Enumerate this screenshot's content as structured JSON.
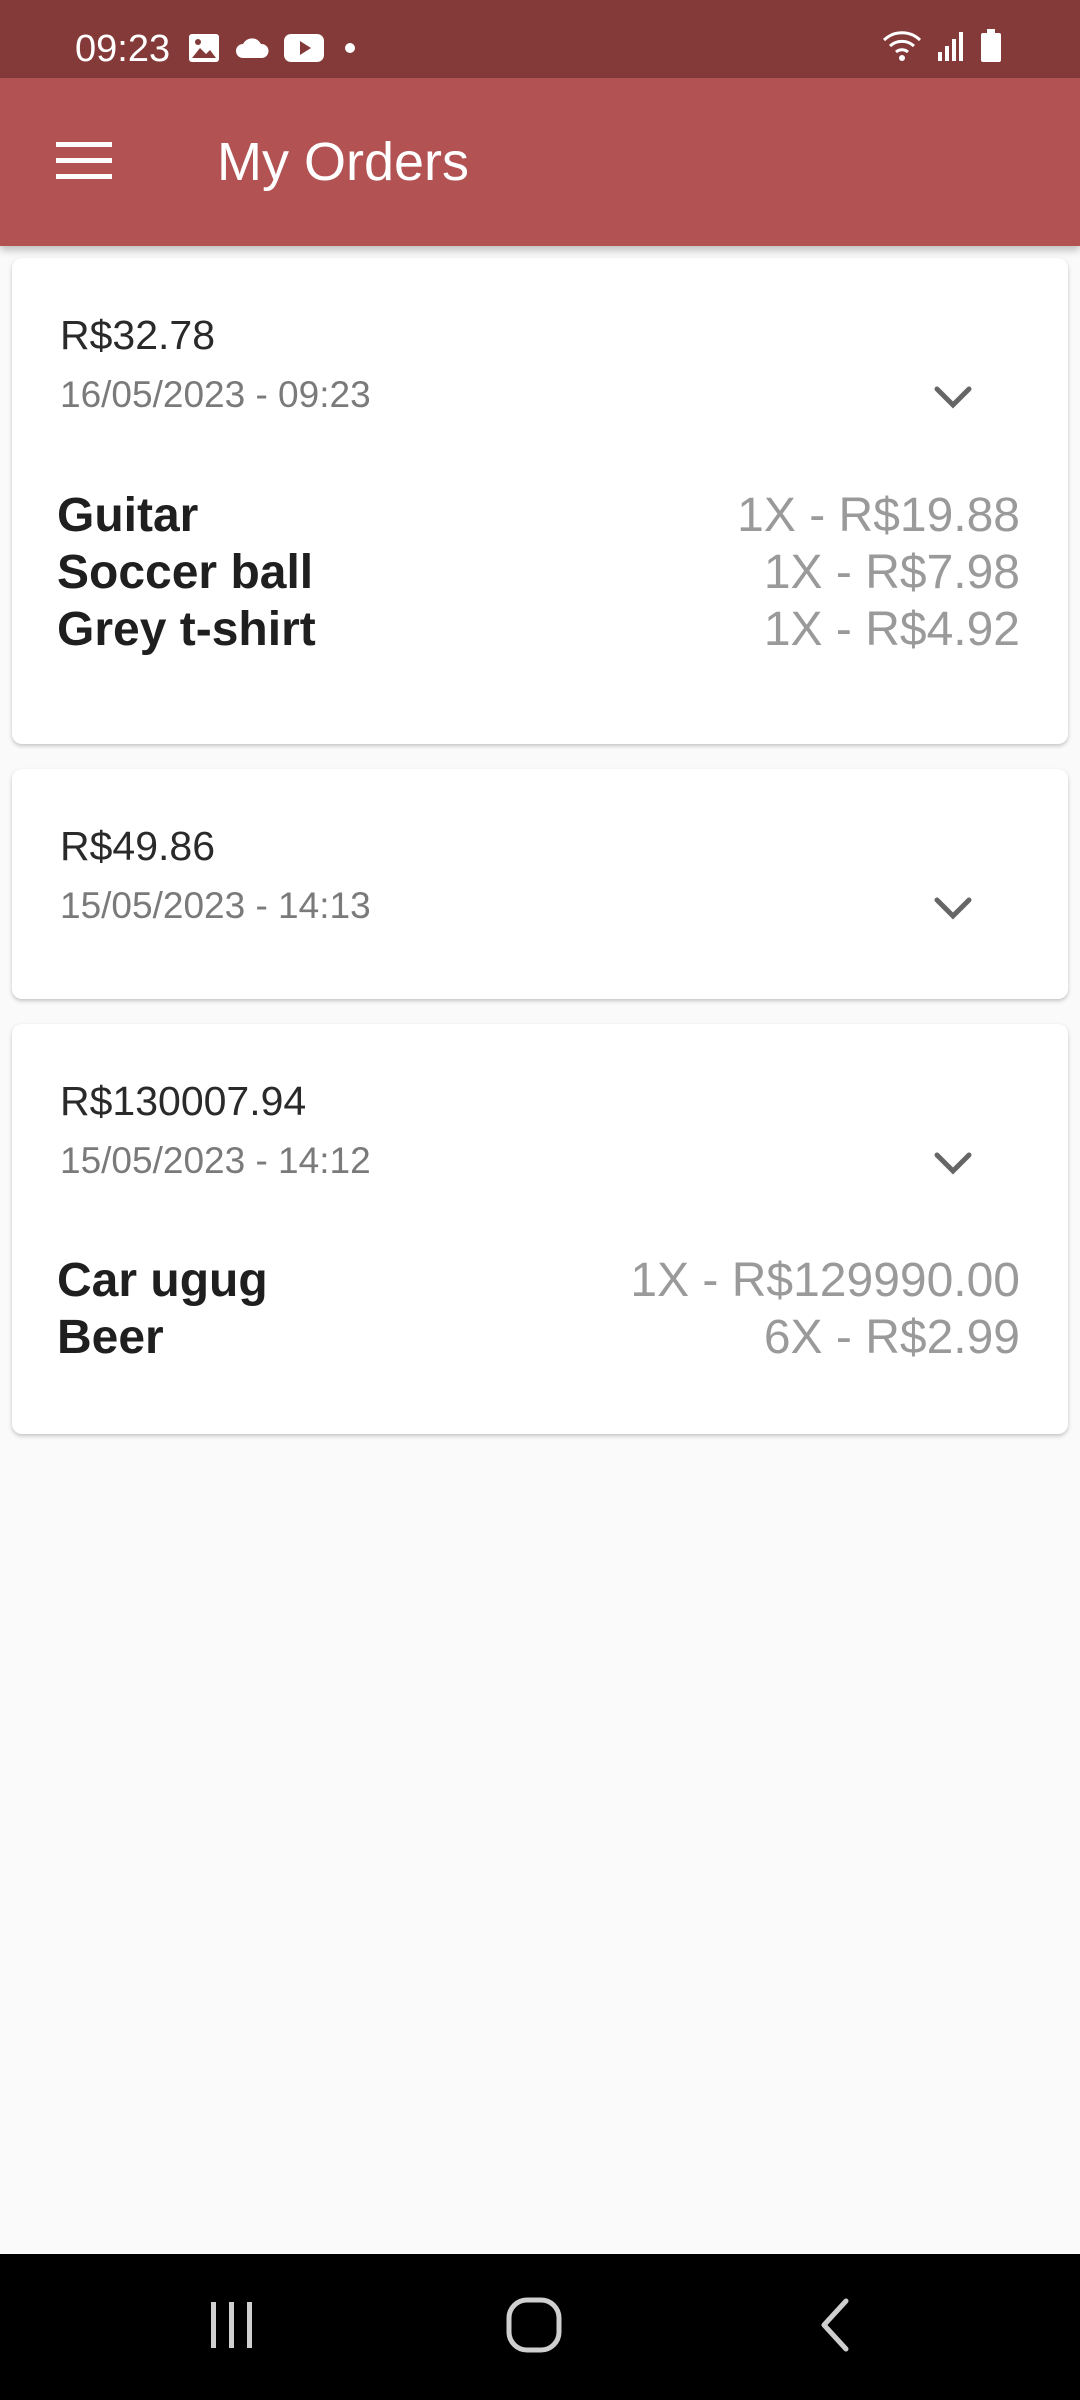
{
  "status_bar": {
    "time": "09:23",
    "left_icons": [
      "image-icon",
      "cloud-icon",
      "youtube-icon",
      "dot-icon"
    ],
    "right_icons": [
      "wifi-icon",
      "signal-icon",
      "battery-icon"
    ]
  },
  "app_bar": {
    "title": "My Orders",
    "menu_icon": "hamburger-menu-icon",
    "color": "#b25252"
  },
  "orders": [
    {
      "total": "R$32.78",
      "date": "16/05/2023 - 09:23",
      "items": [
        {
          "name": "Guitar",
          "qty_price": "1X - R$19.88"
        },
        {
          "name": "Soccer ball",
          "qty_price": "1X - R$7.98"
        },
        {
          "name": "Grey t-shirt",
          "qty_price": "1X - R$4.92"
        }
      ]
    },
    {
      "total": "R$49.86",
      "date": "15/05/2023 - 14:13",
      "items": []
    },
    {
      "total": "R$130007.94",
      "date": "15/05/2023 - 14:12",
      "items": [
        {
          "name": "Car ugug",
          "qty_price": "1X - R$129990.00"
        },
        {
          "name": "Beer",
          "qty_price": "6X - R$2.99"
        }
      ]
    }
  ],
  "nav_bar": {
    "buttons": [
      "recent-apps-icon",
      "home-icon",
      "back-icon"
    ]
  }
}
